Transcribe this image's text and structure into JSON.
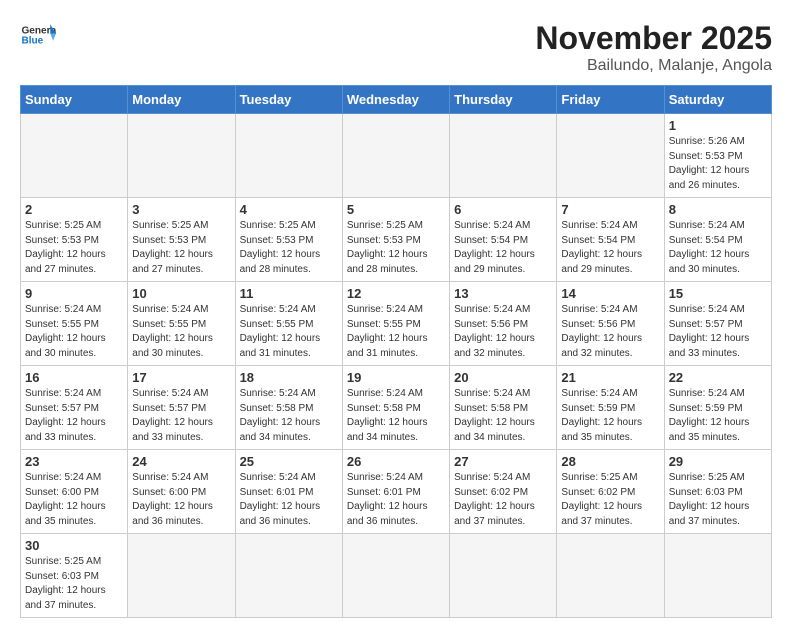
{
  "logo": {
    "general": "General",
    "blue": "Blue"
  },
  "title": "November 2025",
  "subtitle": "Bailundo, Malanje, Angola",
  "weekdays": [
    "Sunday",
    "Monday",
    "Tuesday",
    "Wednesday",
    "Thursday",
    "Friday",
    "Saturday"
  ],
  "days": [
    {
      "date": "",
      "sunrise": "",
      "sunset": "",
      "daylight": "",
      "empty": true
    },
    {
      "date": "",
      "sunrise": "",
      "sunset": "",
      "daylight": "",
      "empty": true
    },
    {
      "date": "",
      "sunrise": "",
      "sunset": "",
      "daylight": "",
      "empty": true
    },
    {
      "date": "",
      "sunrise": "",
      "sunset": "",
      "daylight": "",
      "empty": true
    },
    {
      "date": "",
      "sunrise": "",
      "sunset": "",
      "daylight": "",
      "empty": true
    },
    {
      "date": "",
      "sunrise": "",
      "sunset": "",
      "daylight": "",
      "empty": true
    },
    {
      "date": "1",
      "sunrise": "Sunrise: 5:26 AM",
      "sunset": "Sunset: 5:53 PM",
      "daylight": "Daylight: 12 hours and 26 minutes.",
      "empty": false
    },
    {
      "date": "2",
      "sunrise": "Sunrise: 5:25 AM",
      "sunset": "Sunset: 5:53 PM",
      "daylight": "Daylight: 12 hours and 27 minutes.",
      "empty": false
    },
    {
      "date": "3",
      "sunrise": "Sunrise: 5:25 AM",
      "sunset": "Sunset: 5:53 PM",
      "daylight": "Daylight: 12 hours and 27 minutes.",
      "empty": false
    },
    {
      "date": "4",
      "sunrise": "Sunrise: 5:25 AM",
      "sunset": "Sunset: 5:53 PM",
      "daylight": "Daylight: 12 hours and 28 minutes.",
      "empty": false
    },
    {
      "date": "5",
      "sunrise": "Sunrise: 5:25 AM",
      "sunset": "Sunset: 5:53 PM",
      "daylight": "Daylight: 12 hours and 28 minutes.",
      "empty": false
    },
    {
      "date": "6",
      "sunrise": "Sunrise: 5:24 AM",
      "sunset": "Sunset: 5:54 PM",
      "daylight": "Daylight: 12 hours and 29 minutes.",
      "empty": false
    },
    {
      "date": "7",
      "sunrise": "Sunrise: 5:24 AM",
      "sunset": "Sunset: 5:54 PM",
      "daylight": "Daylight: 12 hours and 29 minutes.",
      "empty": false
    },
    {
      "date": "8",
      "sunrise": "Sunrise: 5:24 AM",
      "sunset": "Sunset: 5:54 PM",
      "daylight": "Daylight: 12 hours and 30 minutes.",
      "empty": false
    },
    {
      "date": "9",
      "sunrise": "Sunrise: 5:24 AM",
      "sunset": "Sunset: 5:55 PM",
      "daylight": "Daylight: 12 hours and 30 minutes.",
      "empty": false
    },
    {
      "date": "10",
      "sunrise": "Sunrise: 5:24 AM",
      "sunset": "Sunset: 5:55 PM",
      "daylight": "Daylight: 12 hours and 30 minutes.",
      "empty": false
    },
    {
      "date": "11",
      "sunrise": "Sunrise: 5:24 AM",
      "sunset": "Sunset: 5:55 PM",
      "daylight": "Daylight: 12 hours and 31 minutes.",
      "empty": false
    },
    {
      "date": "12",
      "sunrise": "Sunrise: 5:24 AM",
      "sunset": "Sunset: 5:55 PM",
      "daylight": "Daylight: 12 hours and 31 minutes.",
      "empty": false
    },
    {
      "date": "13",
      "sunrise": "Sunrise: 5:24 AM",
      "sunset": "Sunset: 5:56 PM",
      "daylight": "Daylight: 12 hours and 32 minutes.",
      "empty": false
    },
    {
      "date": "14",
      "sunrise": "Sunrise: 5:24 AM",
      "sunset": "Sunset: 5:56 PM",
      "daylight": "Daylight: 12 hours and 32 minutes.",
      "empty": false
    },
    {
      "date": "15",
      "sunrise": "Sunrise: 5:24 AM",
      "sunset": "Sunset: 5:57 PM",
      "daylight": "Daylight: 12 hours and 33 minutes.",
      "empty": false
    },
    {
      "date": "16",
      "sunrise": "Sunrise: 5:24 AM",
      "sunset": "Sunset: 5:57 PM",
      "daylight": "Daylight: 12 hours and 33 minutes.",
      "empty": false
    },
    {
      "date": "17",
      "sunrise": "Sunrise: 5:24 AM",
      "sunset": "Sunset: 5:57 PM",
      "daylight": "Daylight: 12 hours and 33 minutes.",
      "empty": false
    },
    {
      "date": "18",
      "sunrise": "Sunrise: 5:24 AM",
      "sunset": "Sunset: 5:58 PM",
      "daylight": "Daylight: 12 hours and 34 minutes.",
      "empty": false
    },
    {
      "date": "19",
      "sunrise": "Sunrise: 5:24 AM",
      "sunset": "Sunset: 5:58 PM",
      "daylight": "Daylight: 12 hours and 34 minutes.",
      "empty": false
    },
    {
      "date": "20",
      "sunrise": "Sunrise: 5:24 AM",
      "sunset": "Sunset: 5:58 PM",
      "daylight": "Daylight: 12 hours and 34 minutes.",
      "empty": false
    },
    {
      "date": "21",
      "sunrise": "Sunrise: 5:24 AM",
      "sunset": "Sunset: 5:59 PM",
      "daylight": "Daylight: 12 hours and 35 minutes.",
      "empty": false
    },
    {
      "date": "22",
      "sunrise": "Sunrise: 5:24 AM",
      "sunset": "Sunset: 5:59 PM",
      "daylight": "Daylight: 12 hours and 35 minutes.",
      "empty": false
    },
    {
      "date": "23",
      "sunrise": "Sunrise: 5:24 AM",
      "sunset": "Sunset: 6:00 PM",
      "daylight": "Daylight: 12 hours and 35 minutes.",
      "empty": false
    },
    {
      "date": "24",
      "sunrise": "Sunrise: 5:24 AM",
      "sunset": "Sunset: 6:00 PM",
      "daylight": "Daylight: 12 hours and 36 minutes.",
      "empty": false
    },
    {
      "date": "25",
      "sunrise": "Sunrise: 5:24 AM",
      "sunset": "Sunset: 6:01 PM",
      "daylight": "Daylight: 12 hours and 36 minutes.",
      "empty": false
    },
    {
      "date": "26",
      "sunrise": "Sunrise: 5:24 AM",
      "sunset": "Sunset: 6:01 PM",
      "daylight": "Daylight: 12 hours and 36 minutes.",
      "empty": false
    },
    {
      "date": "27",
      "sunrise": "Sunrise: 5:24 AM",
      "sunset": "Sunset: 6:02 PM",
      "daylight": "Daylight: 12 hours and 37 minutes.",
      "empty": false
    },
    {
      "date": "28",
      "sunrise": "Sunrise: 5:25 AM",
      "sunset": "Sunset: 6:02 PM",
      "daylight": "Daylight: 12 hours and 37 minutes.",
      "empty": false
    },
    {
      "date": "29",
      "sunrise": "Sunrise: 5:25 AM",
      "sunset": "Sunset: 6:03 PM",
      "daylight": "Daylight: 12 hours and 37 minutes.",
      "empty": false
    },
    {
      "date": "30",
      "sunrise": "Sunrise: 5:25 AM",
      "sunset": "Sunset: 6:03 PM",
      "daylight": "Daylight: 12 hours and 37 minutes.",
      "empty": false
    },
    {
      "date": "",
      "sunrise": "",
      "sunset": "",
      "daylight": "",
      "empty": true
    },
    {
      "date": "",
      "sunrise": "",
      "sunset": "",
      "daylight": "",
      "empty": true
    },
    {
      "date": "",
      "sunrise": "",
      "sunset": "",
      "daylight": "",
      "empty": true
    },
    {
      "date": "",
      "sunrise": "",
      "sunset": "",
      "daylight": "",
      "empty": true
    },
    {
      "date": "",
      "sunrise": "",
      "sunset": "",
      "daylight": "",
      "empty": true
    },
    {
      "date": "",
      "sunrise": "",
      "sunset": "",
      "daylight": "",
      "empty": true
    }
  ]
}
